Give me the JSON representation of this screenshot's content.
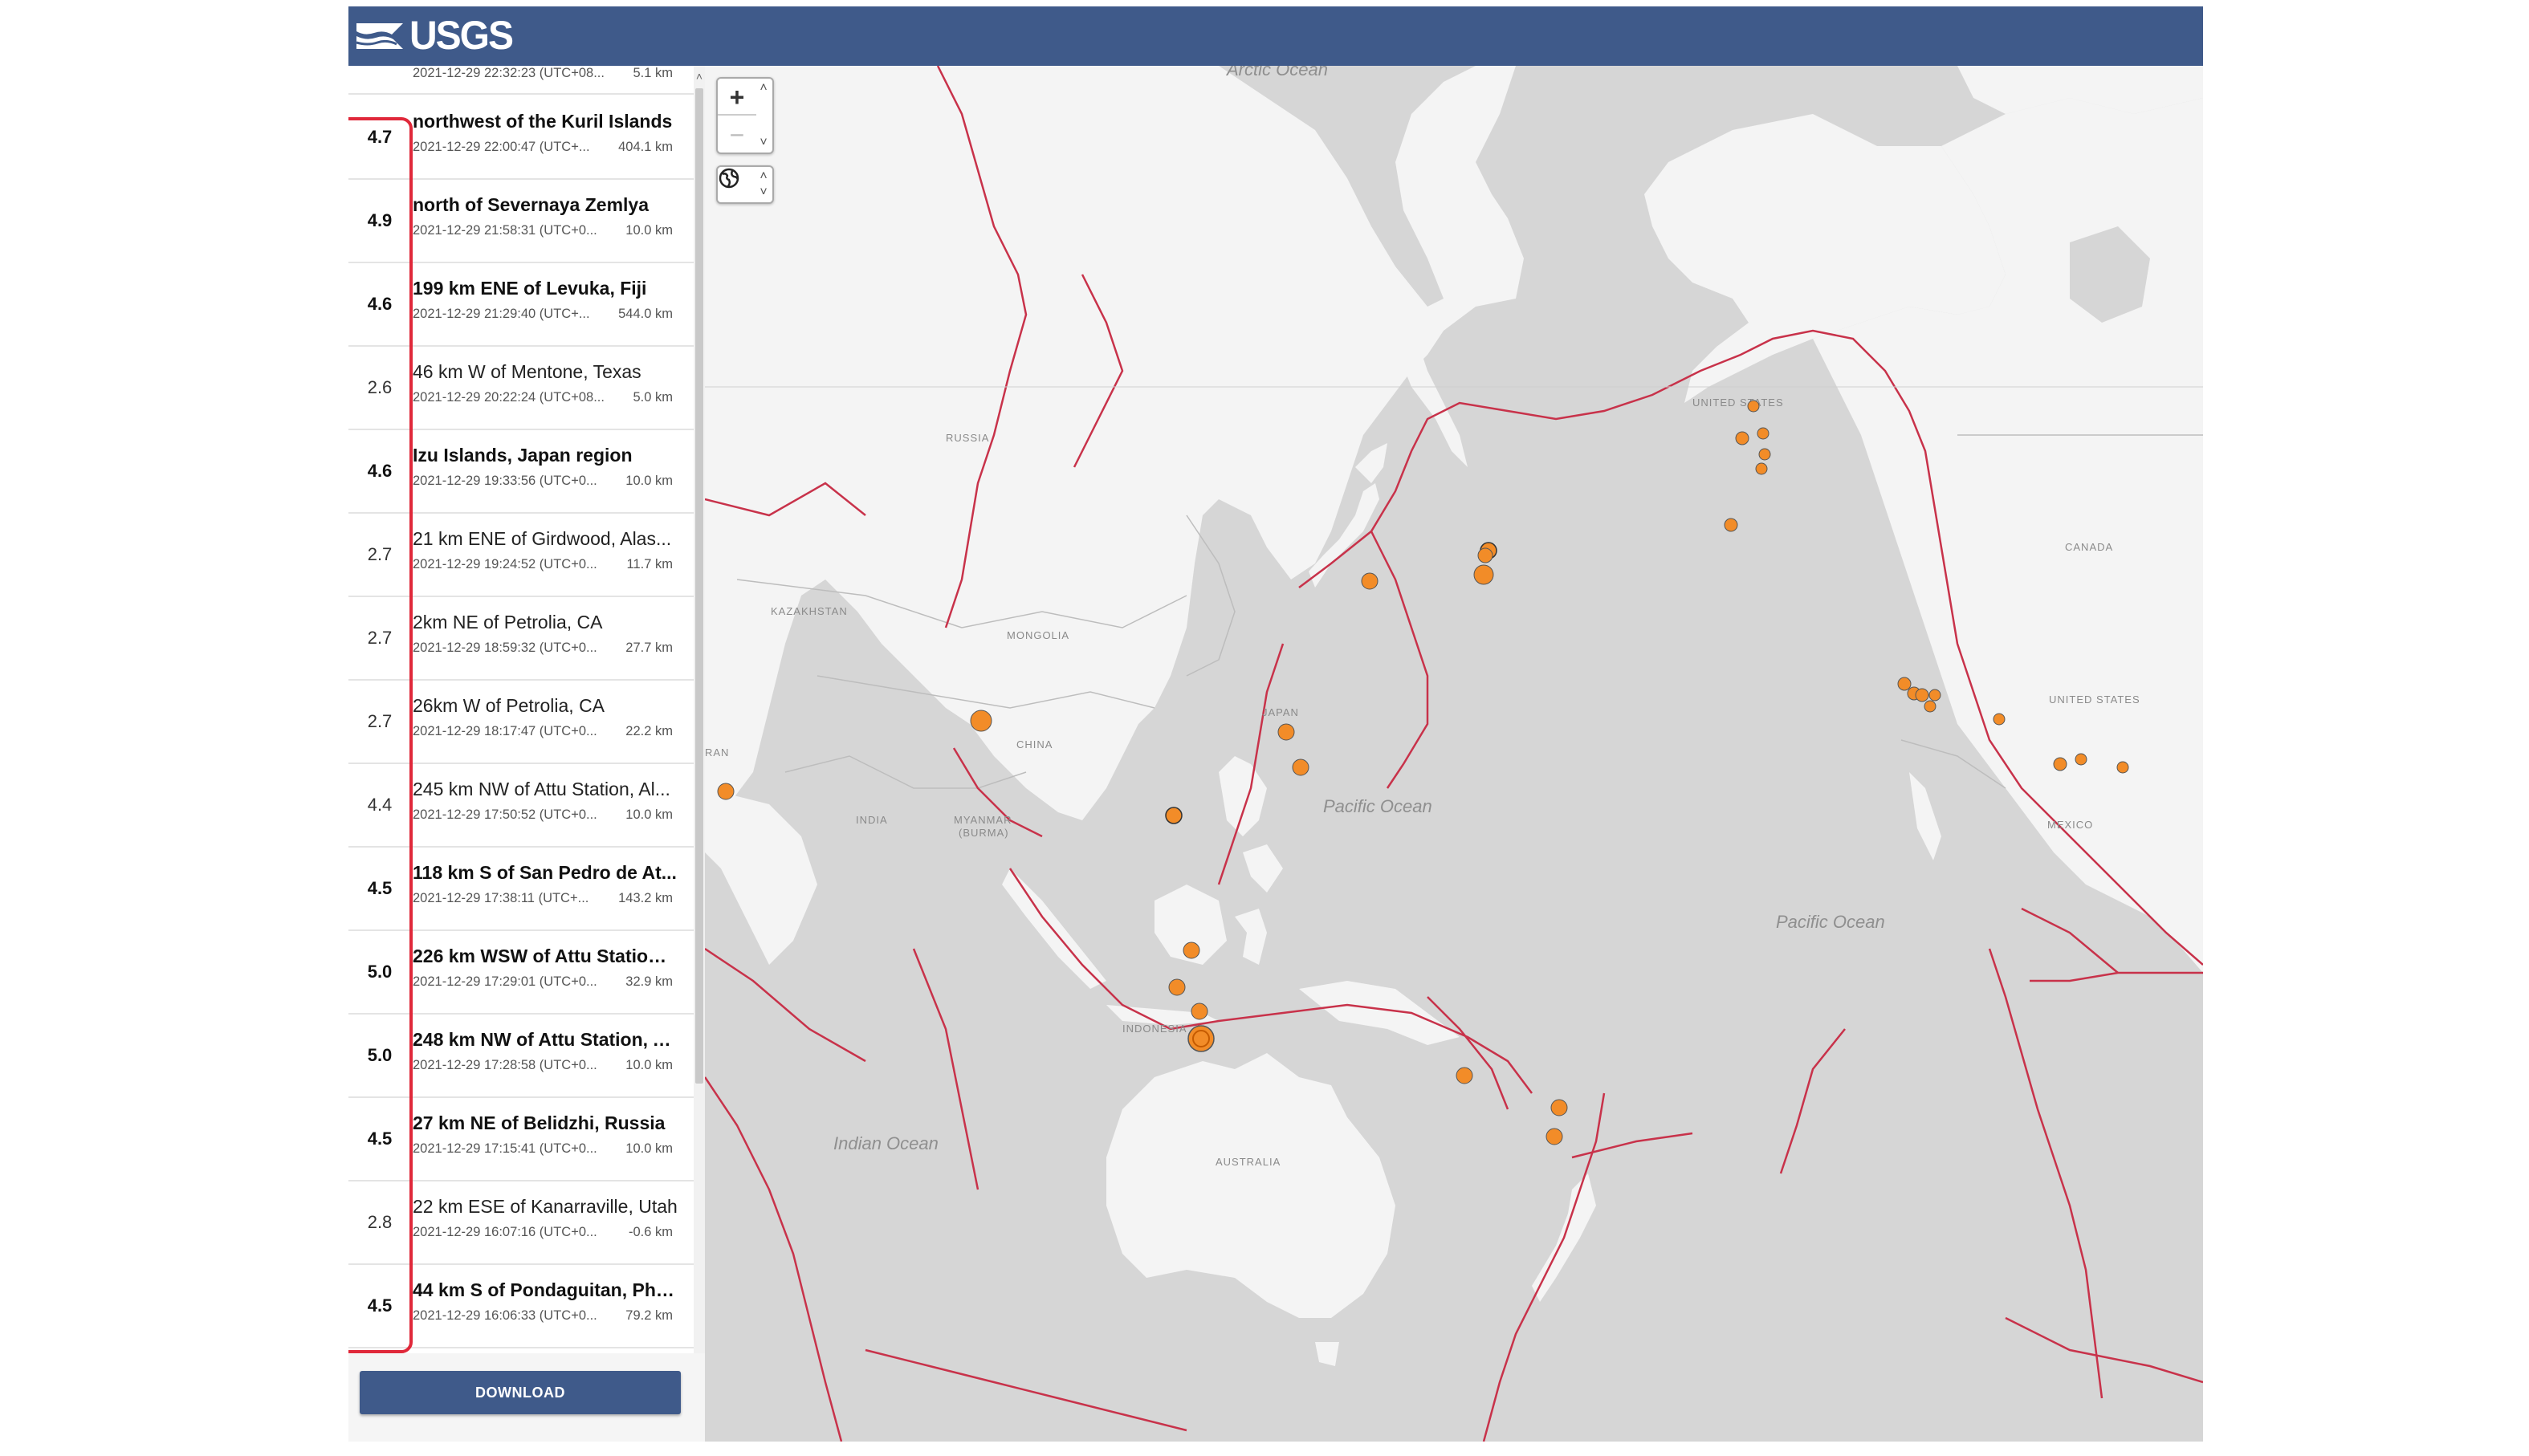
{
  "header": {
    "logo_text": "USGS"
  },
  "list": {
    "partial_row": {
      "time": "2021-12-29 22:32:23 (UTC+08...",
      "depth": "5.1 km"
    },
    "rows": [
      {
        "mag": "4.7",
        "place": "northwest of the Kuril Islands",
        "time": "2021-12-29 22:00:47 (UTC+...",
        "depth": "404.1 km",
        "strong": true
      },
      {
        "mag": "4.9",
        "place": "north of Severnaya Zemlya",
        "time": "2021-12-29 21:58:31 (UTC+0...",
        "depth": "10.0 km",
        "strong": true
      },
      {
        "mag": "4.6",
        "place": "199 km ENE of Levuka, Fiji",
        "time": "2021-12-29 21:29:40 (UTC+...",
        "depth": "544.0 km",
        "strong": true
      },
      {
        "mag": "2.6",
        "place": "46 km W of Mentone, Texas",
        "time": "2021-12-29 20:22:24 (UTC+08...",
        "depth": "5.0 km",
        "strong": false
      },
      {
        "mag": "4.6",
        "place": "Izu Islands, Japan region",
        "time": "2021-12-29 19:33:56 (UTC+0...",
        "depth": "10.0 km",
        "strong": true
      },
      {
        "mag": "2.7",
        "place": "21 km ENE of Girdwood, Alas...",
        "time": "2021-12-29 19:24:52 (UTC+0...",
        "depth": "11.7 km",
        "strong": false
      },
      {
        "mag": "2.7",
        "place": "2km NE of Petrolia, CA",
        "time": "2021-12-29 18:59:32 (UTC+0...",
        "depth": "27.7 km",
        "strong": false
      },
      {
        "mag": "2.7",
        "place": "26km W of Petrolia, CA",
        "time": "2021-12-29 18:17:47 (UTC+0...",
        "depth": "22.2 km",
        "strong": false
      },
      {
        "mag": "4.4",
        "place": "245 km NW of Attu Station, Al...",
        "time": "2021-12-29 17:50:52 (UTC+0...",
        "depth": "10.0 km",
        "strong": false
      },
      {
        "mag": "4.5",
        "place": "118 km S of San Pedro de At...",
        "time": "2021-12-29 17:38:11 (UTC+...",
        "depth": "143.2 km",
        "strong": true
      },
      {
        "mag": "5.0",
        "place": "226 km WSW of Attu Station,...",
        "time": "2021-12-29 17:29:01 (UTC+0...",
        "depth": "32.9 km",
        "strong": true
      },
      {
        "mag": "5.0",
        "place": "248 km NW of Attu Station, A...",
        "time": "2021-12-29 17:28:58 (UTC+0...",
        "depth": "10.0 km",
        "strong": true
      },
      {
        "mag": "4.5",
        "place": "27 km NE of Belidzhi, Russia",
        "time": "2021-12-29 17:15:41 (UTC+0...",
        "depth": "10.0 km",
        "strong": true
      },
      {
        "mag": "2.8",
        "place": "22 km ESE of Kanarraville, Utah",
        "time": "2021-12-29 16:07:16 (UTC+0...",
        "depth": "-0.6 km",
        "strong": false
      },
      {
        "mag": "4.5",
        "place": "44 km S of Pondaguitan, Phil...",
        "time": "2021-12-29 16:06:33 (UTC+0...",
        "depth": "79.2 km",
        "strong": true
      }
    ]
  },
  "footer": {
    "download_label": "DOWNLOAD"
  },
  "map": {
    "zoom_in_label": "+",
    "zoom_out_label": "−",
    "spin_up": "˄",
    "spin_down": "˅",
    "icons": {
      "zoom_in": "plus-icon",
      "zoom_out": "minus-icon",
      "globe": "globe-icon",
      "scroll_up": "chevron-up-icon"
    },
    "labels": {
      "arctic_ocean": "Arctic Ocean",
      "russia": "RUSSIA",
      "kazakhstan": "KAZAKHSTAN",
      "mongolia": "MONGOLIA",
      "china": "CHINA",
      "iran": "RAN",
      "india": "INDIA",
      "myanmar": "MYANMAR",
      "burma": "(BURMA)",
      "japan": "JAPAN",
      "pacific_ocean_1": "Pacific Ocean",
      "pacific_ocean_2": "Pacific Ocean",
      "indian_ocean": "Indian Ocean",
      "indonesia": "INDONESIA",
      "australia": "AUSTRALIA",
      "united_states_ak": "UNITED STATES",
      "canada": "CANADA",
      "united_states": "UNITED STATES",
      "mexico": "MEXICO"
    }
  },
  "colors": {
    "header": "#3f5a8a",
    "highlight": "#e0283a",
    "plate_boundary": "#c8324a",
    "quake": "#f28c28",
    "ocean": "#d6d6d6",
    "land": "#f4f4f4"
  }
}
